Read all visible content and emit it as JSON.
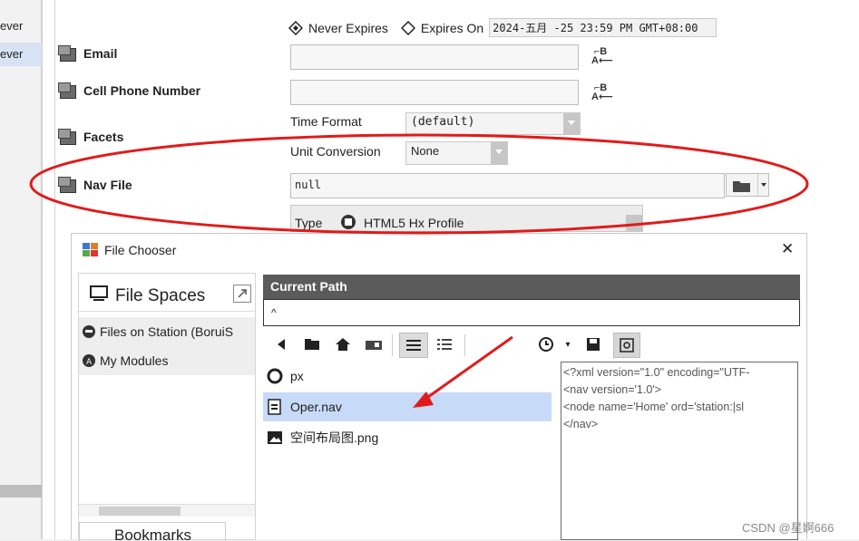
{
  "left_strip": {
    "items": [
      {
        "label": "ever",
        "selected": false
      },
      {
        "label": "ever",
        "selected": true
      }
    ]
  },
  "properties": {
    "expiry": {
      "never_expires_label": "Never Expires",
      "expires_on_label": "Expires On",
      "expires_on_value": "2024-五月 -25 23:59 PM GMT+08:00",
      "selected": "never_expires"
    },
    "email": {
      "label": "Email",
      "value": ""
    },
    "cell_phone": {
      "label": "Cell Phone Number",
      "value": ""
    },
    "facets": {
      "label": "Facets",
      "time_format_label": "Time Format",
      "time_format_value": "(default)",
      "unit_conversion_label": "Unit Conversion",
      "unit_conversion_value": "None"
    },
    "nav_file": {
      "label": "Nav File",
      "value": "null"
    },
    "type": {
      "label": "Type",
      "value": "HTML5 Hx Profile"
    },
    "ab_icon_text": "A→B"
  },
  "dialog": {
    "title": "File Chooser",
    "close_glyph": "✕",
    "file_spaces": {
      "title": "File Spaces",
      "items": [
        {
          "label": "Files on Station (BoruiS",
          "icon": "station-icon"
        },
        {
          "label": "My Modules",
          "icon": "module-icon"
        }
      ],
      "bottom_tab_label": "Bookmarks"
    },
    "current_path": {
      "header": "Current Path",
      "value": "^"
    },
    "files": [
      {
        "name": "px",
        "icon": "folder-icon",
        "selected": false
      },
      {
        "name": "Oper.nav",
        "icon": "nav-file-icon",
        "selected": true
      },
      {
        "name": "空间布局图.png",
        "icon": "image-file-icon",
        "selected": false
      }
    ],
    "preview_lines": [
      "<?xml version=\"1.0\" encoding=\"UTF-",
      "<nav version='1.0'>",
      "<node name='Home' ord='station:|sl",
      "</nav>"
    ]
  },
  "watermark": "CSDN @星婀666",
  "colors": {
    "annotation_red": "#e01b1b",
    "selection_blue": "#c7daf7",
    "header_gray": "#5b5b5b"
  }
}
